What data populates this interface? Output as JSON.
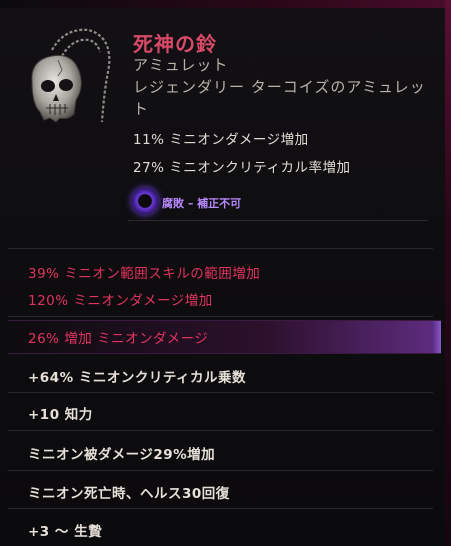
{
  "item": {
    "name": "死神の鈴",
    "type": "アミュレット",
    "rarity_line": "レジェンダリー ターコイズのアミュレット",
    "implicits": [
      "11% ミニオンダメージ増加",
      "27% ミニオンクリティカル率増加"
    ],
    "corruption_label": "腐敗 – 補正不可"
  },
  "affixes": [
    {
      "text": "39% ミニオン範囲スキルの範囲増加",
      "style": "red"
    },
    {
      "text": "120% ミニオンダメージ増加",
      "style": "red"
    },
    {
      "text": "26% 増加 ミニオンダメージ",
      "style": "red"
    },
    {
      "text": "+64% ミニオンクリティカル乗数",
      "style": "white"
    },
    {
      "text": "+10 知力",
      "style": "white"
    },
    {
      "text": "ミニオン被ダメージ29%増加",
      "style": "white"
    },
    {
      "text": "ミニオン死亡時、ヘルス30回復",
      "style": "white"
    },
    {
      "text": "+3 〜 生贄",
      "style": "white"
    }
  ],
  "colors": {
    "name": "#d94a68",
    "red_affix": "#e0345e",
    "corruption": "#b98aff",
    "highlight": "#8a59c9"
  },
  "icons": {
    "item_icon": "skull-amulet-icon",
    "corruption_icon": "corruption-gem-icon"
  }
}
